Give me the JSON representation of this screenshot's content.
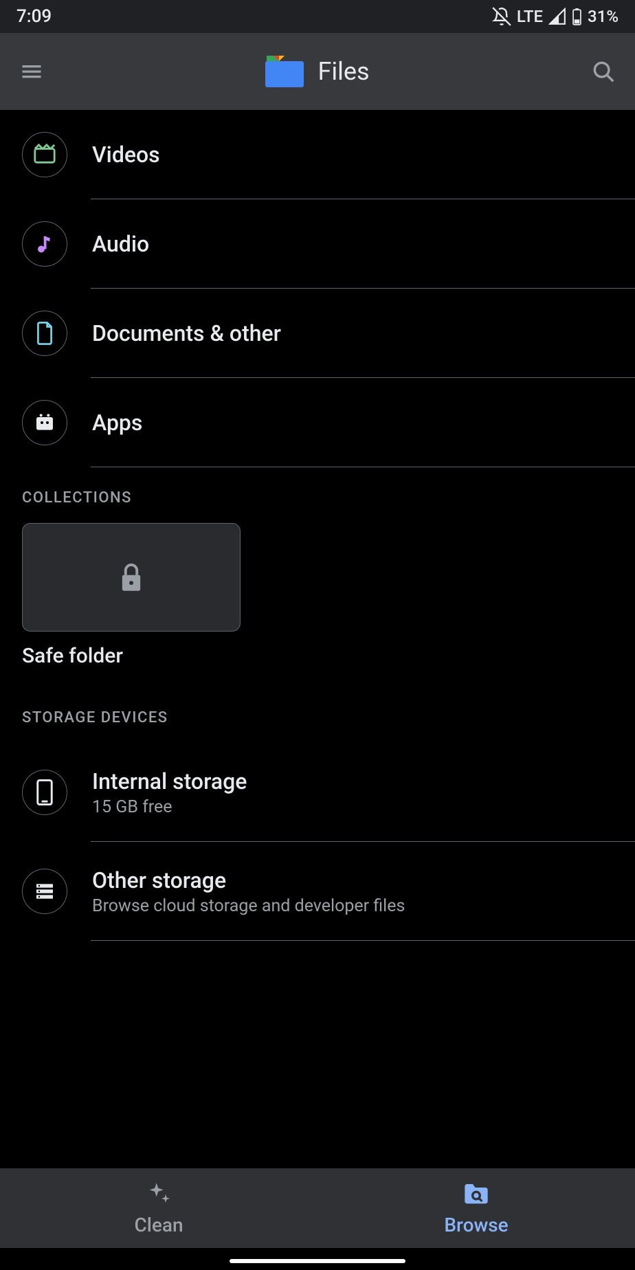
{
  "status": {
    "time": "7:09",
    "network": "LTE",
    "battery": "31%"
  },
  "appbar": {
    "title": "Files"
  },
  "categories": [
    {
      "label": "Videos",
      "icon": "video"
    },
    {
      "label": "Audio",
      "icon": "audio"
    },
    {
      "label": "Documents & other",
      "icon": "document"
    },
    {
      "label": "Apps",
      "icon": "apps"
    }
  ],
  "sections": {
    "collections": "COLLECTIONS",
    "storage": "STORAGE DEVICES"
  },
  "collections": [
    {
      "title": "Safe folder",
      "icon": "lock"
    }
  ],
  "storage": [
    {
      "title": "Internal storage",
      "subtitle": "15 GB free",
      "icon": "phone"
    },
    {
      "title": "Other storage",
      "subtitle": "Browse cloud storage and developer files",
      "icon": "storage"
    }
  ],
  "bottomnav": {
    "clean": "Clean",
    "browse": "Browse"
  }
}
